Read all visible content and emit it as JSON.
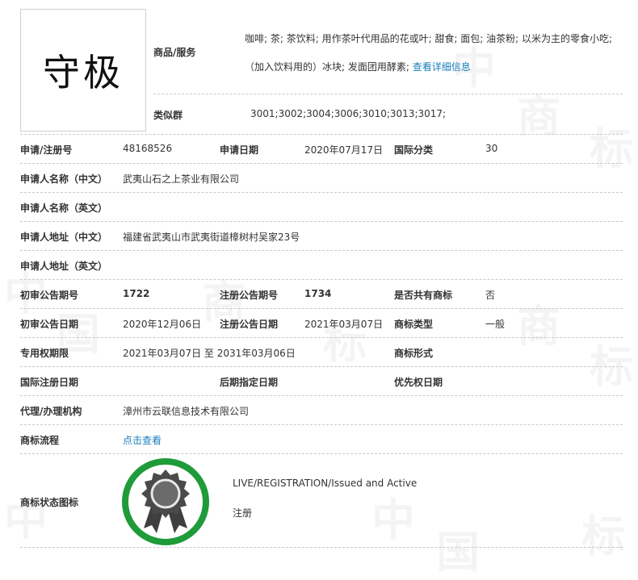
{
  "mark": {
    "name": "守极"
  },
  "goods_services": {
    "label": "商品/服务",
    "line1": "咖啡; 茶; 茶饮料; 用作茶叶代用品的花或叶; 甜食; 面包; 油茶粉; 以米为主的零食小吃;",
    "line2": "（加入饮料用的）冰块; 发面团用酵素;",
    "detail_link": "查看详细信息"
  },
  "similar_group": {
    "label": "类似群",
    "value": "3001;3002;3004;3006;3010;3013;3017;"
  },
  "rows": {
    "reg_no": {
      "label": "申请/注册号",
      "value": "48168526"
    },
    "apply_date": {
      "label": "申请日期",
      "value": "2020年07月17日"
    },
    "intl_class": {
      "label": "国际分类",
      "value": "30"
    },
    "applicant_cn": {
      "label": "申请人名称（中文）",
      "value": "武夷山石之上茶业有限公司"
    },
    "applicant_en": {
      "label": "申请人名称（英文）",
      "value": ""
    },
    "address_cn": {
      "label": "申请人地址（中文）",
      "value": "福建省武夷山市武夷街道樟树村吴家23号"
    },
    "address_en": {
      "label": "申请人地址（英文）",
      "value": ""
    },
    "prelim_issue": {
      "label": "初审公告期号",
      "value": "1722"
    },
    "reg_issue": {
      "label": "注册公告期号",
      "value": "1734"
    },
    "shared": {
      "label": "是否共有商标",
      "value": "否"
    },
    "prelim_date": {
      "label": "初审公告日期",
      "value": "2020年12月06日"
    },
    "reg_date": {
      "label": "注册公告日期",
      "value": "2021年03月07日"
    },
    "mark_type": {
      "label": "商标类型",
      "value": "一般"
    },
    "exclusive_period": {
      "label": "专用权期限",
      "value": "2021年03月07日 至 2031年03月06日"
    },
    "mark_form": {
      "label": "商标形式",
      "value": ""
    },
    "intl_reg_date": {
      "label": "国际注册日期",
      "value": ""
    },
    "later_designation": {
      "label": "后期指定日期",
      "value": ""
    },
    "priority_date": {
      "label": "优先权日期",
      "value": ""
    },
    "agent": {
      "label": "代理/办理机构",
      "value": "漳州市云联信息技术有限公司"
    },
    "process": {
      "label": "商标流程",
      "link": "点击查看"
    },
    "status_icon": {
      "label": "商标状态图标",
      "status_en": "LIVE/REGISTRATION/Issued and Active",
      "status_cn": "注册"
    }
  },
  "watermark": {
    "chars": [
      "中",
      "国",
      "商",
      "标"
    ]
  },
  "colors": {
    "link": "#1a7fbd",
    "status_ring": "#1f9b3a",
    "badge": "#4a4a4a"
  },
  "icons": {
    "status_badge": "award-rosette-icon"
  }
}
